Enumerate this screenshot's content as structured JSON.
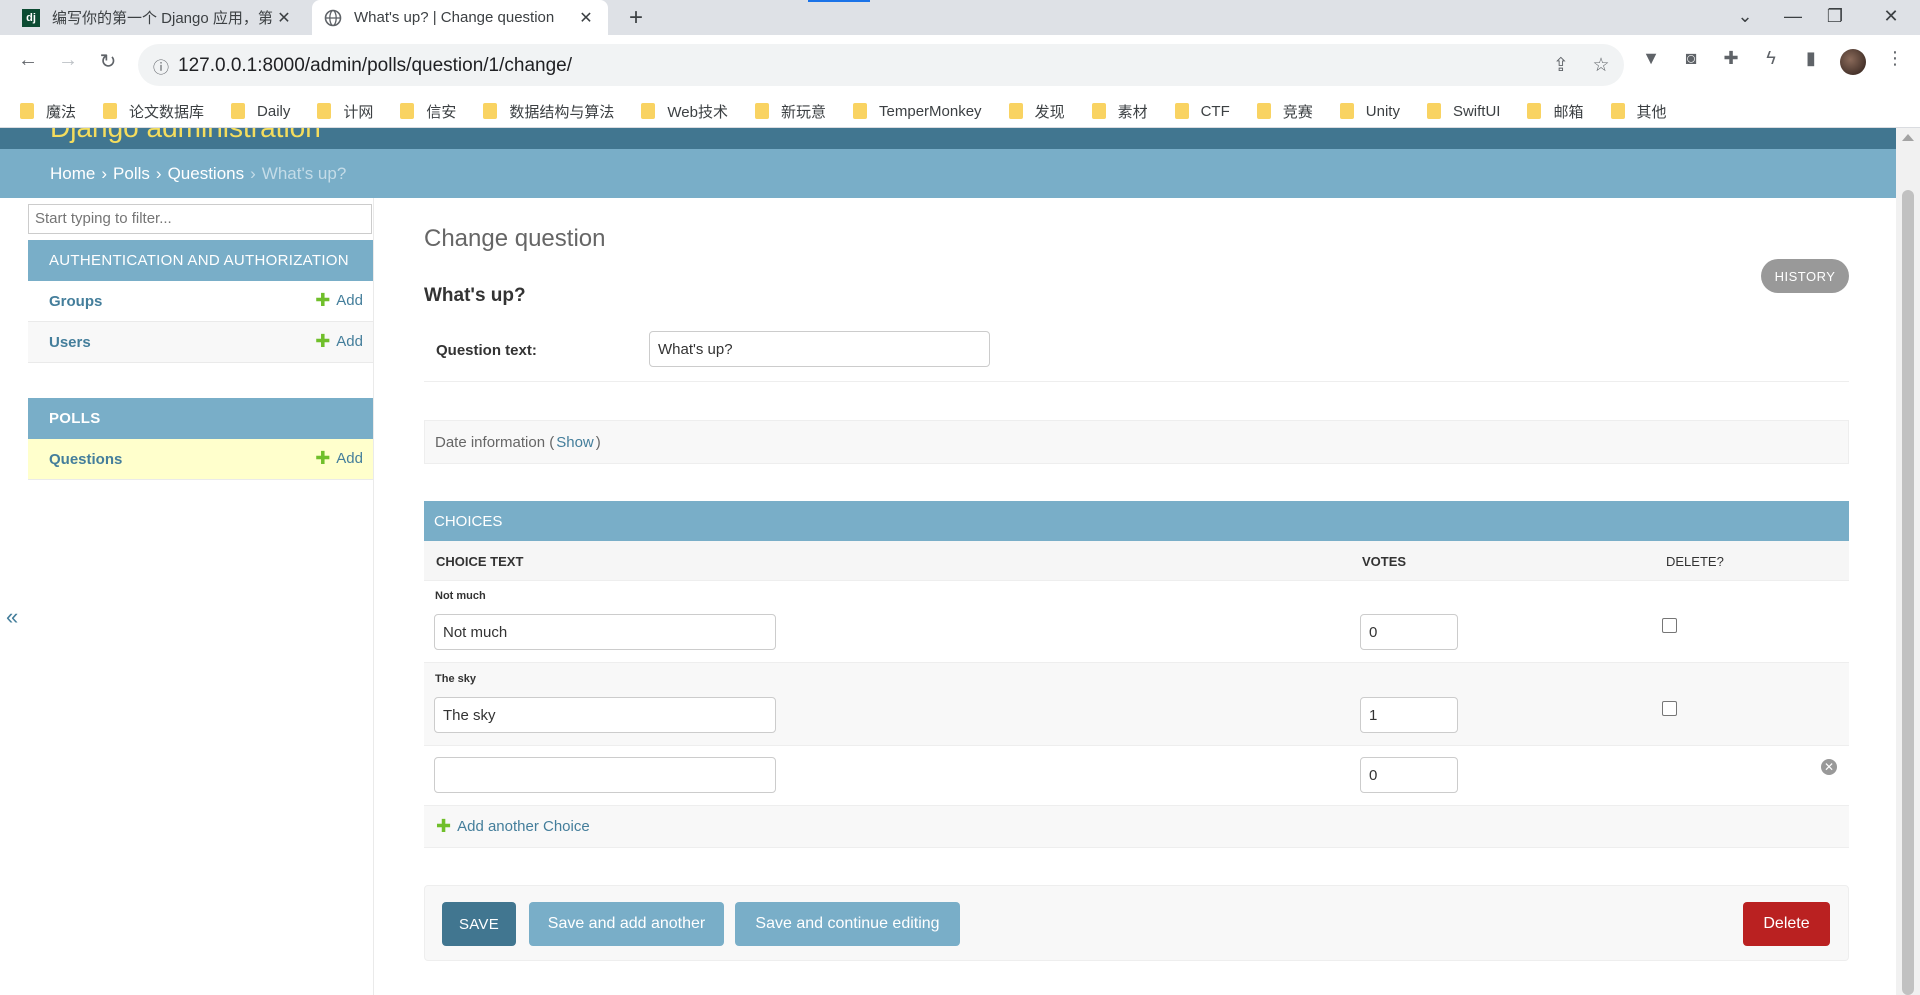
{
  "browser": {
    "tabs": [
      {
        "title": "编写你的第一个 Django 应用，第",
        "favicon": "dj"
      },
      {
        "title": "What's up? | Change question",
        "favicon": "globe-icon"
      }
    ],
    "new_tab": "+",
    "window_controls": {
      "minimize": "—",
      "maximize": "❐",
      "close": "✕",
      "tab_list": "⌄"
    },
    "url": "127.0.0.1:8000/admin/polls/question/1/change/",
    "bookmarks": [
      "魔法",
      "论文数据库",
      "Daily",
      "计网",
      "信安",
      "数据结构与算法",
      "Web技术",
      "新玩意",
      "TemperMonkey",
      "发现",
      "素材",
      "CTF",
      "竞赛",
      "Unity",
      "SwiftUI",
      "邮箱",
      "其他"
    ]
  },
  "admin": {
    "branding": "Django administration",
    "breadcrumbs": {
      "home": "Home",
      "app": "Polls",
      "model": "Questions",
      "current": "What's up?",
      "sep": "›"
    },
    "filter_placeholder": "Start typing to filter...",
    "nav_toggle": "«",
    "modules": [
      {
        "caption": "AUTHENTICATION AND AUTHORIZATION",
        "rows": [
          {
            "label": "Groups",
            "add": "Add"
          },
          {
            "label": "Users",
            "add": "Add"
          }
        ]
      },
      {
        "caption": "POLLS",
        "rows": [
          {
            "label": "Questions",
            "add": "Add"
          }
        ]
      }
    ],
    "content_title": "Change question",
    "history": "HISTORY",
    "object_title": "What's up?",
    "question_label": "Question text:",
    "question_value": "What's up?",
    "date_info": {
      "label": "Date information",
      "open": "(",
      "show": "Show",
      "close": ")"
    },
    "inline": {
      "caption": "CHOICES",
      "headers": {
        "choice_text": "CHOICE TEXT",
        "votes": "VOTES",
        "delete": "DELETE?"
      },
      "rows": [
        {
          "original": "Not much",
          "text": "Not much",
          "votes": "0"
        },
        {
          "original": "The sky",
          "text": "The sky",
          "votes": "1"
        },
        {
          "original": "",
          "text": "",
          "votes": "0"
        }
      ],
      "add_another": "Add another Choice"
    },
    "buttons": {
      "save": "SAVE",
      "save_add": "Save and add another",
      "save_continue": "Save and continue editing",
      "delete": "Delete"
    },
    "colors": {
      "header": "#417690",
      "breadcrumb": "#79aec8",
      "link": "#447e9b",
      "delete": "#ba2121",
      "add_plus": "#70bf2b"
    }
  }
}
